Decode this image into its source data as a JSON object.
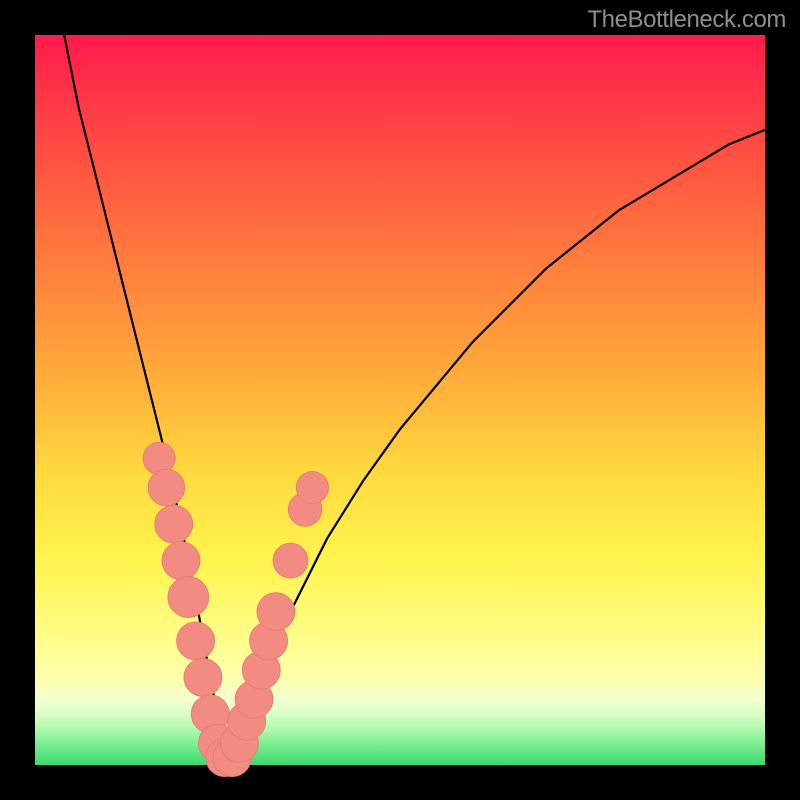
{
  "watermark": "TheBottleneck.com",
  "colors": {
    "frame_bg_top": "#ff1a4d",
    "frame_bg_bottom": "#39d96f",
    "curve": "#000000",
    "marker_fill": "#f28b82",
    "marker_stroke": "#e4786d"
  },
  "chart_data": {
    "type": "line",
    "title": "",
    "xlabel": "",
    "ylabel": "",
    "xlim": [
      0,
      100
    ],
    "ylim": [
      0,
      100
    ],
    "grid": false,
    "legend": false,
    "description": "Bottleneck curve. y approximates bottleneck percentage (100 at top, 0 at bottom). Minimum near x ≈ 26. Left branch very steep; right branch rises gently.",
    "series": [
      {
        "name": "curve",
        "x": [
          0,
          2,
          4,
          6,
          8,
          10,
          12,
          14,
          16,
          18,
          20,
          22,
          24,
          26,
          28,
          30,
          32,
          35,
          40,
          45,
          50,
          55,
          60,
          65,
          70,
          75,
          80,
          85,
          90,
          95,
          100
        ],
        "y": [
          200,
          112,
          100,
          90,
          82,
          74,
          66,
          58,
          50,
          42,
          33,
          23,
          12,
          2,
          2,
          7,
          14,
          21,
          31,
          39,
          46,
          52,
          58,
          63,
          68,
          72,
          76,
          79,
          82,
          85,
          87
        ]
      }
    ],
    "markers": [
      {
        "x": 17,
        "y": 42,
        "r": 2.2
      },
      {
        "x": 18,
        "y": 38,
        "r": 2.5
      },
      {
        "x": 19,
        "y": 33,
        "r": 2.6
      },
      {
        "x": 20,
        "y": 28,
        "r": 2.6
      },
      {
        "x": 21,
        "y": 23,
        "r": 2.8
      },
      {
        "x": 22,
        "y": 17,
        "r": 2.6
      },
      {
        "x": 23,
        "y": 12,
        "r": 2.6
      },
      {
        "x": 24,
        "y": 7,
        "r": 2.6
      },
      {
        "x": 25,
        "y": 3,
        "r": 2.6
      },
      {
        "x": 26,
        "y": 1,
        "r": 2.6
      },
      {
        "x": 27,
        "y": 1,
        "r": 2.6
      },
      {
        "x": 28,
        "y": 3,
        "r": 2.6
      },
      {
        "x": 29,
        "y": 6,
        "r": 2.6
      },
      {
        "x": 30,
        "y": 9,
        "r": 2.6
      },
      {
        "x": 31,
        "y": 13,
        "r": 2.6
      },
      {
        "x": 32,
        "y": 17,
        "r": 2.6
      },
      {
        "x": 33,
        "y": 21,
        "r": 2.6
      },
      {
        "x": 35,
        "y": 28,
        "r": 2.4
      },
      {
        "x": 37,
        "y": 35,
        "r": 2.3
      },
      {
        "x": 38,
        "y": 38,
        "r": 2.2
      }
    ]
  }
}
